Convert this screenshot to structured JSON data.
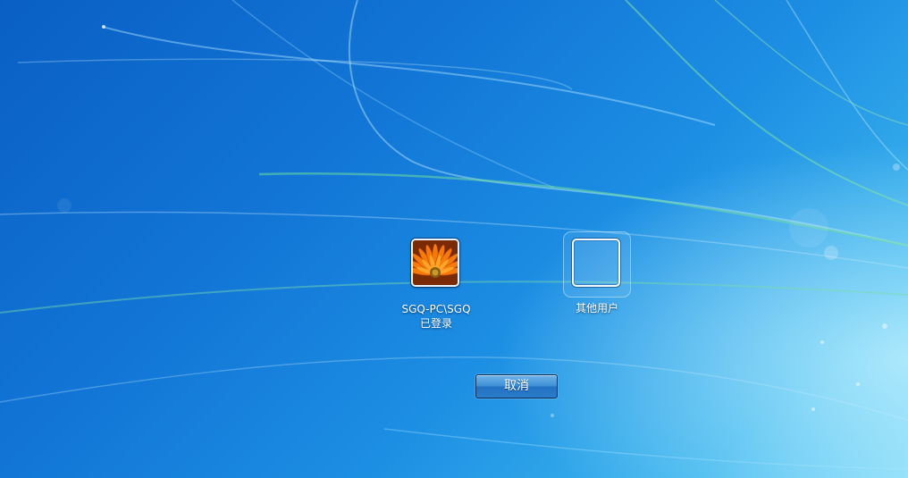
{
  "accounts": {
    "current_user": {
      "name": "SGQ-PC\\SGQ",
      "status": "已登录",
      "avatar_icon": "orange-flower-avatar-icon"
    },
    "other_user": {
      "label": "其他用户",
      "icon": "blank-user-frame-icon"
    }
  },
  "actions": {
    "cancel_label": "取消"
  },
  "colors": {
    "background_dark": "#0a5fc4",
    "background_light": "#7fd8f8",
    "button_blue": "#3f8fd6",
    "avatar_orange": "#f07a10"
  }
}
